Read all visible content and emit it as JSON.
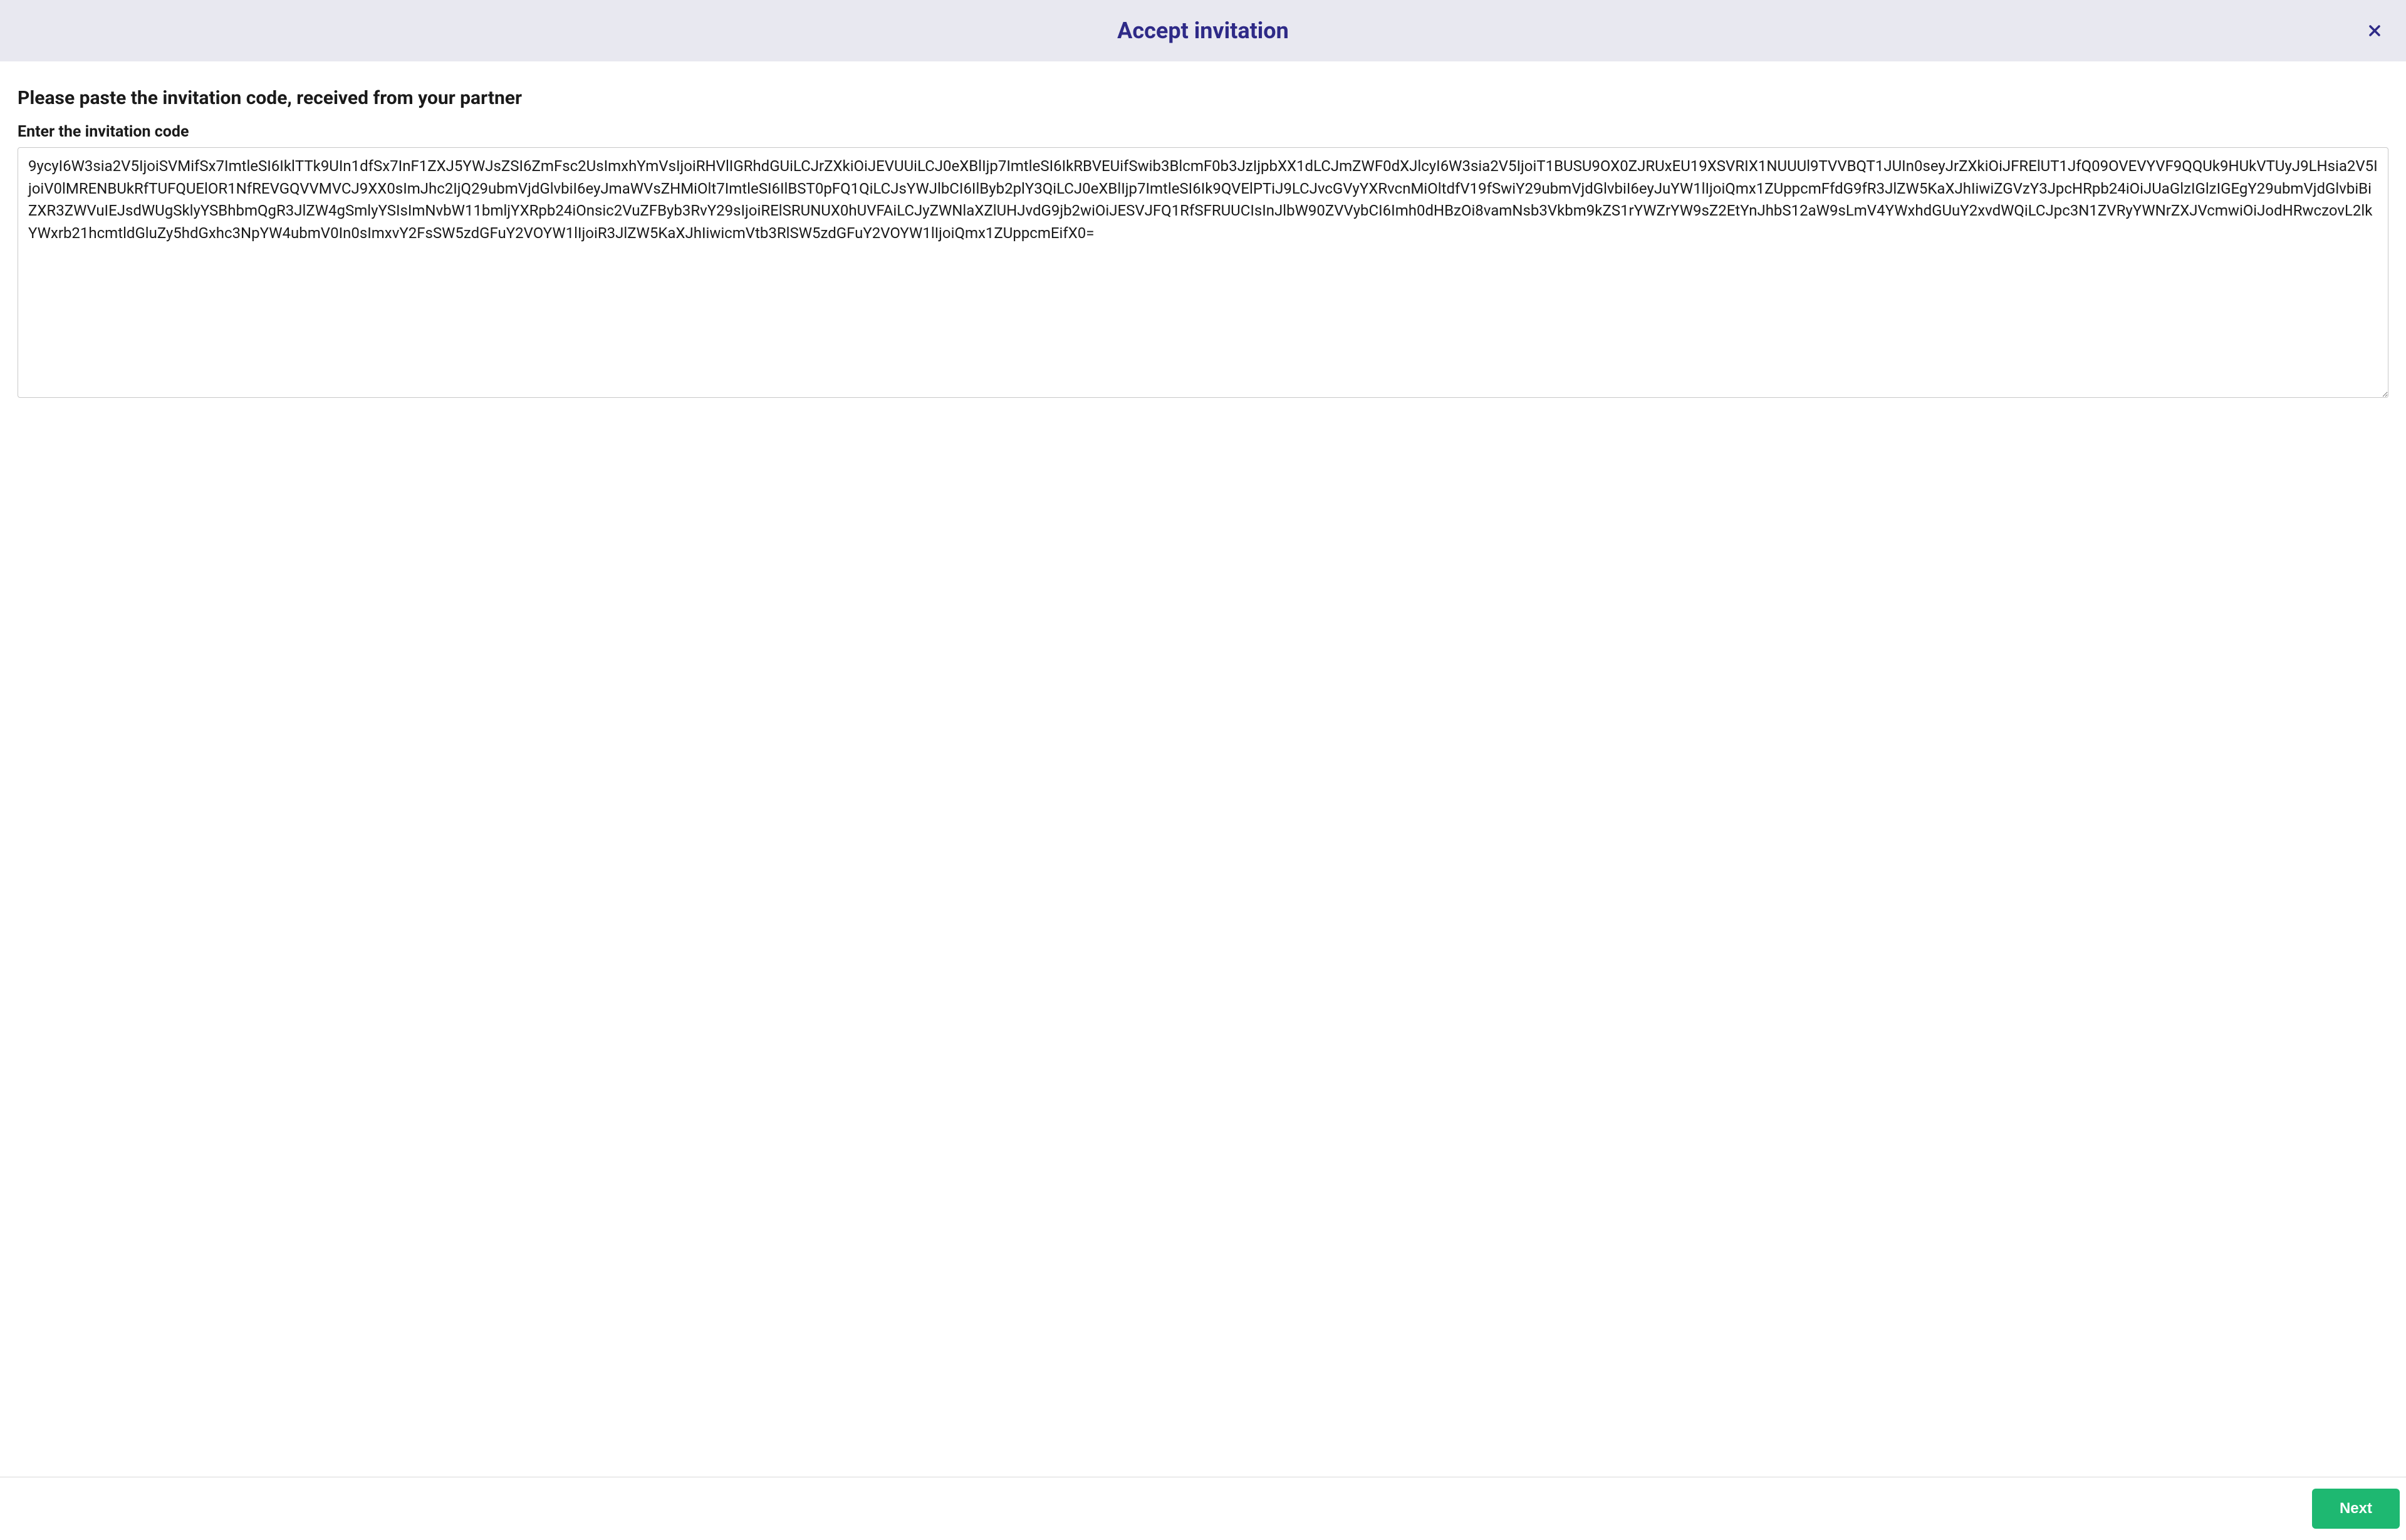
{
  "header": {
    "title": "Accept invitation"
  },
  "body": {
    "instruction": "Please paste the invitation code, received from your partner",
    "field_label": "Enter the invitation code",
    "code_value": "9ycyI6W3sia2V5IjoiSVMifSx7ImtleSI6IklTTk9UIn1dfSx7InF1ZXJ5YWJsZSI6ZmFsc2UsImxhYmVsIjoiRHVlIGRhdGUiLCJrZXkiOiJEVUUiLCJ0eXBlIjp7ImtleSI6IkRBVEUifSwib3BlcmF0b3JzIjpbXX1dLCJmZWF0dXJlcyI6W3sia2V5IjoiT1BUSU9OX0ZJRUxEU19XSVRIX1NUUUl9TVVBQT1JUIn0seyJrZXkiOiJFRElUT1JfQ09OVEVYVF9QQUk9HUkVTUyJ9LHsia2V5IjoiV0lMRENBUkRfTUFQUElOR1NfREVGQVVMVCJ9XX0sImJhc2IjQ29ubmVjdGlvbiI6eyJmaWVsZHMiOlt7ImtleSI6IlBST0pFQ1QiLCJsYWJlbCI6IlByb2plY3QiLCJ0eXBlIjp7ImtleSI6Ik9QVElPTiJ9LCJvcGVyYXRvcnMiOltdfV19fSwiY29ubmVjdGlvbiI6eyJuYW1lIjoiQmx1ZUppcmFfdG9fR3JlZW5KaXJhIiwiZGVzY3JpcHRpb24iOiJUaGlzIGlzIGEgY29ubmVjdGlvbiBiZXR3ZWVuIEJsdWUgSklyYSBhbmQgR3JlZW4gSmlyYSIsImNvbW11bmljYXRpb24iOnsic2VuZFByb3RvY29sIjoiRElSRUNUX0hUVFAiLCJyZWNlaXZlUHJvdG9jb2wiOiJESVJFQ1RfSFRUUCIsInJlbW90ZVVybCI6Imh0dHBzOi8vamNsb3Vkbm9kZS1rYWZrYW9sZ2EtYnJhbS12aW9sLmV4YWxhdGUuY2xvdWQiLCJpc3N1ZVRyYWNrZXJVcmwiOiJodHRwczovL2lkYWxrb21hcmtldGluZy5hdGxhc3NpYW4ubmV0In0sImxvY2FsSW5zdGFuY2VOYW1lIjoiR3JlZW5KaXJhIiwicmVtb3RlSW5zdGFuY2VOYW1lIjoiQmx1ZUppcmEifX0="
  },
  "footer": {
    "next_label": "Next"
  },
  "colors": {
    "header_bg": "#e8e8f0",
    "title_color": "#2e2a87",
    "next_button_bg": "#1eb871"
  }
}
